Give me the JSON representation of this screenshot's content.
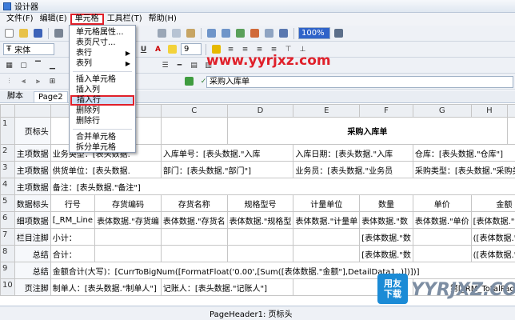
{
  "window": {
    "title": "设计器"
  },
  "menu": {
    "file": "文件(F)",
    "edit": "编辑(E)",
    "cell": "单元格",
    "toolbar": "工具栏(T)",
    "help": "帮助(H)"
  },
  "toolbar": {
    "font_name": "宋体",
    "font_size": "9",
    "zoom": "100%",
    "formula_value": "采购入库单"
  },
  "dropdown": {
    "items": [
      "单元格属性...",
      "表页尺寸...",
      "表行",
      "表列",
      "插入单元格",
      "插入列",
      "插入行",
      "删除列",
      "删除行",
      "合并单元格",
      "拆分单元格"
    ],
    "highlighted": "插入行"
  },
  "watermark": "www.yyrjxz.com",
  "tabs": [
    "脚本",
    "Page2"
  ],
  "grid": {
    "columns": [
      "A",
      "B",
      "C",
      "D",
      "E",
      "F",
      "G",
      "H",
      "I"
    ],
    "rows": [
      {
        "num": "1",
        "band": "页标头",
        "cells": [
          "",
          "",
          "",
          "采购入库单",
          "",
          "",
          "",
          "",
          ""
        ]
      },
      {
        "num": "2",
        "band": "主项数据",
        "cells": [
          "业务类型：[表头数据.",
          "入库单号：[表头数据.\"入库",
          "入库日期：[表头数据.\"入库",
          "仓库：[表头数据.\"仓库\"]"
        ]
      },
      {
        "num": "3",
        "band": "主项数据",
        "cells": [
          "供货单位：[表头数据.",
          "部门：[表头数据.\"部门\"]",
          "业务员：[表头数据.\"业务员",
          "采购类型：[表头数据.\"采购类型\"]"
        ]
      },
      {
        "num": "4",
        "band": "主项数据",
        "cells": [
          "备注：[表头数据.\"备注\"]"
        ]
      },
      {
        "num": "5",
        "band": "数据标头",
        "cells": [
          "行号",
          "存货编码",
          "存货名称",
          "规格型号",
          "计量单位",
          "数量",
          "单价",
          "金额"
        ]
      },
      {
        "num": "6",
        "band": "细项数据",
        "cells": [
          "[_RM_Line",
          "表体数据.\"存货编",
          "表体数据.\"存货名",
          "表体数据.\"规格型",
          "表体数据.\"计量单",
          "表体数据.\"数",
          "表体数据.\"单价",
          "[表体数据.\"金额\""
        ]
      },
      {
        "num": "7",
        "band": "栏目注脚",
        "cells": [
          "小计：",
          "",
          "",
          "",
          "",
          "[表体数据.\"数",
          "",
          "([表体数据.\"金额"
        ]
      },
      {
        "num": "8",
        "band": "总结",
        "cells": [
          "合计：",
          "",
          "",
          "",
          "",
          "[表体数据.\"数",
          "",
          "([表体数据.\"金额"
        ]
      },
      {
        "num": "9",
        "band": "总结",
        "cells": [
          "金额合计(大写)：[CurrToBigNum([FormatFloat('0.00',[Sum([表体数据.\"金额\"],DetailData1,,)])])]"
        ]
      },
      {
        "num": "10",
        "band": "页注脚",
        "cells": [
          "制单人：[表头数据.\"制单人\"]",
          "记账人：[表头数据.\"记账人\"]",
          "第[_RM_TotalPages]页"
        ]
      }
    ]
  },
  "status": {
    "text": "PageHeader1: 页标头"
  },
  "logo": {
    "line1": "用友",
    "line2": "下载",
    "text": "YYRJXZ.COM"
  }
}
